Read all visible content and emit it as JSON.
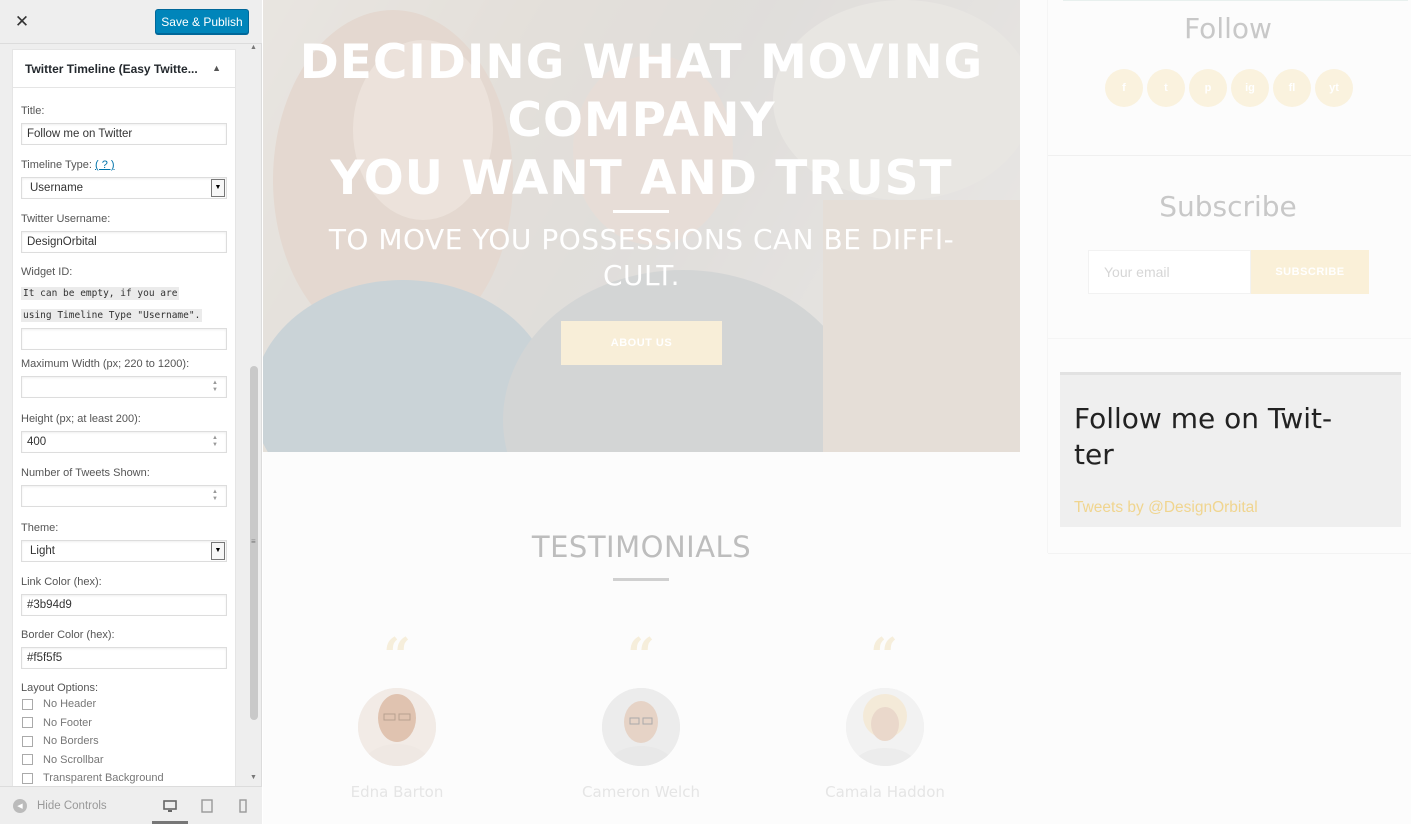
{
  "header": {
    "close_glyph": "✕",
    "save_label": "Save & Publish"
  },
  "widget": {
    "title": "Twitter Timeline (Easy Twitte...",
    "toggle_glyph": "▲",
    "fields": {
      "title_label": "Title:",
      "title_value": "Follow me on Twitter",
      "timeline_type_label": "Timeline Type:",
      "timeline_type_help": "( ? )",
      "timeline_type_value": "Username",
      "username_label": "Twitter Username:",
      "username_value": "DesignOrbital",
      "widget_id_label": "Widget ID:",
      "widget_id_note_1": "It can be empty, if you are",
      "widget_id_note_2": "using Timeline Type \"Username\".",
      "widget_id_value": "",
      "max_width_label": "Maximum Width (px; 220 to 1200):",
      "max_width_value": "",
      "height_label": "Height (px; at least 200):",
      "height_value": "400",
      "tweets_label": "Number of Tweets Shown:",
      "tweets_value": "",
      "theme_label": "Theme:",
      "theme_value": "Light",
      "link_color_label": "Link Color (hex):",
      "link_color_value": "#3b94d9",
      "border_color_label": "Border Color (hex):",
      "border_color_value": "#f5f5f5",
      "layout_label": "Layout Options:",
      "layout_options": [
        "No Header",
        "No Footer",
        "No Borders",
        "No Scrollbar",
        "Transparent Background"
      ]
    }
  },
  "footer": {
    "hide_label": "Hide Controls",
    "devices": [
      "desktop-icon",
      "tablet-icon",
      "mobile-icon"
    ]
  },
  "preview": {
    "hero_topline": "",
    "hero_title_line1": "DECIDING WHAT MOVING",
    "hero_title_line2": "COMPANY",
    "hero_title_line3": "YOU WANT AND TRUST",
    "hero_sub_line1": "TO MOVE YOU POSSESSIONS CAN BE DIFFI-",
    "hero_sub_line2": "CULT.",
    "hero_button": "ABOUT US",
    "testimonials_title": "TESTIMONIALS",
    "quote_glyph": "“",
    "people": [
      "Edna Barton",
      "Cameron Welch",
      "Camala Haddon"
    ],
    "follow_title": "Follow",
    "social": [
      "f",
      "t",
      "p",
      "ig",
      "fl",
      "yt"
    ],
    "subscribe_title": "Subscribe",
    "subscribe_placeholder": "Your email",
    "subscribe_button": "SUBSCRIBE",
    "twitter_widget_title": "Follow me on Twit- ter",
    "twitter_widget_title_l1": "Follow me on Twit-",
    "twitter_widget_title_l2": "ter",
    "twitter_link": "Tweets by @DesignOrbital"
  },
  "colors": {
    "accent": "#0085ba",
    "gold": "#f0d58f"
  }
}
